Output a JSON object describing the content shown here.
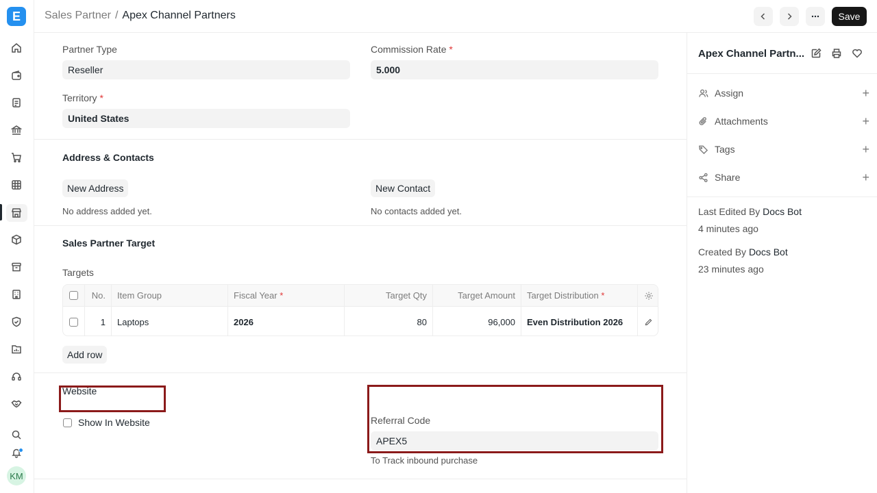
{
  "header": {
    "breadcrumb_parent": "Sales Partner",
    "breadcrumb_sep": "/",
    "breadcrumb_current": "Apex Channel Partners",
    "prev_icon": "chevron-left-icon",
    "next_icon": "chevron-right-icon",
    "more_icon": "ellipsis-icon",
    "save_label": "Save"
  },
  "form": {
    "partner_type": {
      "label": "Partner Type",
      "value": "Reseller"
    },
    "commission_rate": {
      "label": "Commission Rate",
      "value": "5.000",
      "required": "*"
    },
    "territory": {
      "label": "Territory",
      "value": "United States",
      "required": "*"
    }
  },
  "address_contacts": {
    "title": "Address & Contacts",
    "new_address": "New Address",
    "new_contact": "New Contact",
    "no_address": "No address added yet.",
    "no_contacts": "No contacts added yet."
  },
  "targets_section": {
    "title": "Sales Partner Target",
    "table_label": "Targets",
    "columns": {
      "no": "No.",
      "item_group": "Item Group",
      "fiscal_year": "Fiscal Year",
      "target_qty": "Target Qty",
      "target_amount": "Target Amount",
      "target_distribution": "Target Distribution"
    },
    "required": "*",
    "rows": [
      {
        "no": "1",
        "item_group": "Laptops",
        "fiscal_year": "2026",
        "target_qty": "80",
        "target_amount": "96,000",
        "target_distribution": "Even Distribution 2026"
      }
    ],
    "add_row": "Add row"
  },
  "website_section": {
    "title": "Website",
    "show_in_website": "Show In Website",
    "referral_code_label": "Referral Code",
    "referral_code_value": "APEX5",
    "referral_hint": "To Track inbound purchase"
  },
  "sidebar": {
    "title": "Apex Channel Partn...",
    "assign": "Assign",
    "attachments": "Attachments",
    "tags": "Tags",
    "share": "Share",
    "last_edited_prefix": "Last Edited By",
    "last_edited_by": "Docs Bot",
    "last_edited_time": "4 minutes ago",
    "created_prefix": "Created By",
    "created_by": "Docs Bot",
    "created_time": "23 minutes ago"
  },
  "user": {
    "initials": "KM"
  },
  "colors": {
    "accent": "#2490ef",
    "highlight": "#8b1a1a",
    "required": "#e03636"
  }
}
